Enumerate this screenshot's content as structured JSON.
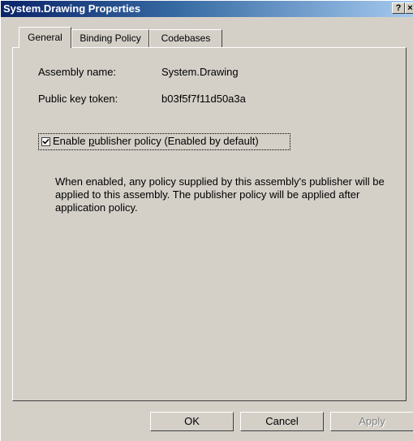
{
  "window": {
    "title": "System.Drawing Properties",
    "help_button": "?",
    "close_button": "×"
  },
  "tabs": [
    {
      "label": "General",
      "active": true
    },
    {
      "label": "Binding Policy",
      "active": false
    },
    {
      "label": "Codebases",
      "active": false
    }
  ],
  "general": {
    "assembly_name_label": "Assembly name:",
    "assembly_name_value": "System.Drawing",
    "public_key_label": "Public key token:",
    "public_key_value": "b03f5f7f11d50a3a",
    "publisher_policy": {
      "label_prefix": "Enable ",
      "label_mnemonic": "p",
      "label_suffix": "ublisher policy (Enabled by default)",
      "checked": true
    },
    "description": "When enabled, any policy supplied by this assembly's publisher will be applied to this assembly.  The publisher policy will be applied after application policy."
  },
  "buttons": {
    "ok": "OK",
    "cancel": "Cancel",
    "apply": "Apply",
    "apply_enabled": false
  }
}
